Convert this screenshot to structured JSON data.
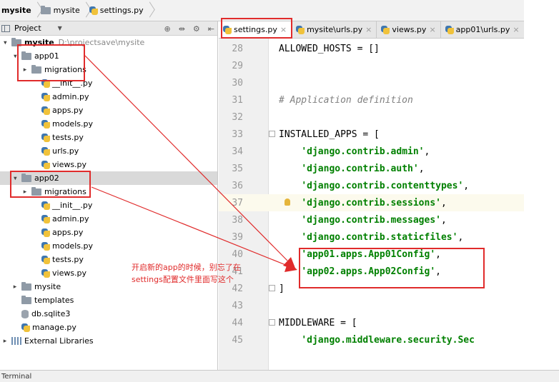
{
  "breadcrumb": [
    "mysite",
    "mysite",
    "settings.py"
  ],
  "project_panel": {
    "title": "Project",
    "tree": [
      {
        "label": "mysite",
        "extra": "D:\\projectsave\\mysite",
        "kind": "folder",
        "level": 0,
        "expanded": true,
        "bold": true
      },
      {
        "label": "app01",
        "kind": "folder",
        "level": 1,
        "expanded": true
      },
      {
        "label": "migrations",
        "kind": "folder",
        "level": 2,
        "expanded": false
      },
      {
        "label": "__init__.py",
        "kind": "py",
        "level": 3
      },
      {
        "label": "admin.py",
        "kind": "py",
        "level": 3
      },
      {
        "label": "apps.py",
        "kind": "py",
        "level": 3
      },
      {
        "label": "models.py",
        "kind": "py",
        "level": 3
      },
      {
        "label": "tests.py",
        "kind": "py",
        "level": 3
      },
      {
        "label": "urls.py",
        "kind": "py",
        "level": 3
      },
      {
        "label": "views.py",
        "kind": "py",
        "level": 3
      },
      {
        "label": "app02",
        "kind": "folder",
        "level": 1,
        "expanded": true,
        "selected": true
      },
      {
        "label": "migrations",
        "kind": "folder",
        "level": 2,
        "expanded": false
      },
      {
        "label": "__init__.py",
        "kind": "py",
        "level": 3
      },
      {
        "label": "admin.py",
        "kind": "py",
        "level": 3
      },
      {
        "label": "apps.py",
        "kind": "py",
        "level": 3
      },
      {
        "label": "models.py",
        "kind": "py",
        "level": 3
      },
      {
        "label": "tests.py",
        "kind": "py",
        "level": 3
      },
      {
        "label": "views.py",
        "kind": "py",
        "level": 3
      },
      {
        "label": "mysite",
        "kind": "folder",
        "level": 1,
        "expanded": false
      },
      {
        "label": "templates",
        "kind": "folder",
        "level": 1
      },
      {
        "label": "db.sqlite3",
        "kind": "db",
        "level": 1
      },
      {
        "label": "manage.py",
        "kind": "py",
        "level": 1
      },
      {
        "label": "External Libraries",
        "kind": "lib",
        "level": 0,
        "expanded": false
      }
    ]
  },
  "editor": {
    "tabs": [
      {
        "label": "settings.py",
        "active": true
      },
      {
        "label": "mysite\\urls.py",
        "active": false
      },
      {
        "label": "views.py",
        "active": false
      },
      {
        "label": "app01\\urls.py",
        "active": false
      }
    ],
    "lines": [
      {
        "num": "28",
        "segments": [
          {
            "t": "ALLOWED_HOSTS = []",
            "c": "plain"
          }
        ]
      },
      {
        "num": "29",
        "segments": []
      },
      {
        "num": "30",
        "segments": []
      },
      {
        "num": "31",
        "segments": [
          {
            "t": "# Application definition",
            "c": "cmt"
          }
        ]
      },
      {
        "num": "32",
        "segments": []
      },
      {
        "num": "33",
        "segments": [
          {
            "t": "INSTALLED_APPS = [",
            "c": "plain"
          }
        ]
      },
      {
        "num": "34",
        "segments": [
          {
            "t": "    ",
            "c": "plain"
          },
          {
            "t": "'django.contrib.admin'",
            "c": "str"
          },
          {
            "t": ",",
            "c": "plain"
          }
        ]
      },
      {
        "num": "35",
        "segments": [
          {
            "t": "    ",
            "c": "plain"
          },
          {
            "t": "'django.contrib.auth'",
            "c": "str"
          },
          {
            "t": ",",
            "c": "plain"
          }
        ]
      },
      {
        "num": "36",
        "segments": [
          {
            "t": "    ",
            "c": "plain"
          },
          {
            "t": "'django.contrib.contenttypes'",
            "c": "str"
          },
          {
            "t": ",",
            "c": "plain"
          }
        ]
      },
      {
        "num": "37",
        "segments": [
          {
            "t": "    ",
            "c": "plain"
          },
          {
            "t": "'django.contrib.sessions'",
            "c": "str"
          },
          {
            "t": ",",
            "c": "plain"
          }
        ]
      },
      {
        "num": "38",
        "segments": [
          {
            "t": "    ",
            "c": "plain"
          },
          {
            "t": "'django.contrib.messages'",
            "c": "str"
          },
          {
            "t": ",",
            "c": "plain"
          }
        ]
      },
      {
        "num": "39",
        "segments": [
          {
            "t": "    ",
            "c": "plain"
          },
          {
            "t": "'django.contrib.staticfiles'",
            "c": "str"
          },
          {
            "t": ",",
            "c": "plain"
          }
        ]
      },
      {
        "num": "40",
        "segments": [
          {
            "t": "    ",
            "c": "plain"
          },
          {
            "t": "'app01.apps.App01Config'",
            "c": "str"
          },
          {
            "t": ",",
            "c": "plain"
          }
        ]
      },
      {
        "num": "41",
        "segments": [
          {
            "t": "    ",
            "c": "plain"
          },
          {
            "t": "'app02.apps.App02Config'",
            "c": "str"
          },
          {
            "t": ",",
            "c": "plain"
          }
        ]
      },
      {
        "num": "42",
        "segments": [
          {
            "t": "]",
            "c": "plain"
          }
        ]
      },
      {
        "num": "43",
        "segments": []
      },
      {
        "num": "44",
        "segments": [
          {
            "t": "MIDDLEWARE = [",
            "c": "plain"
          }
        ]
      },
      {
        "num": "45",
        "segments": [
          {
            "t": "    ",
            "c": "plain"
          },
          {
            "t": "'django.middleware.security.Sec",
            "c": "str"
          }
        ]
      }
    ]
  },
  "annotation": {
    "line1": "开启新的app的时候，别忘了在",
    "line2": "settings配置文件里面写这个",
    "color": "#e02b2b"
  },
  "statusbar": {
    "text": "Terminal"
  },
  "colors": {
    "string": "#008000",
    "comment": "#808080",
    "gutter": "#f0f0f0",
    "highlight": "#e02b2b"
  }
}
